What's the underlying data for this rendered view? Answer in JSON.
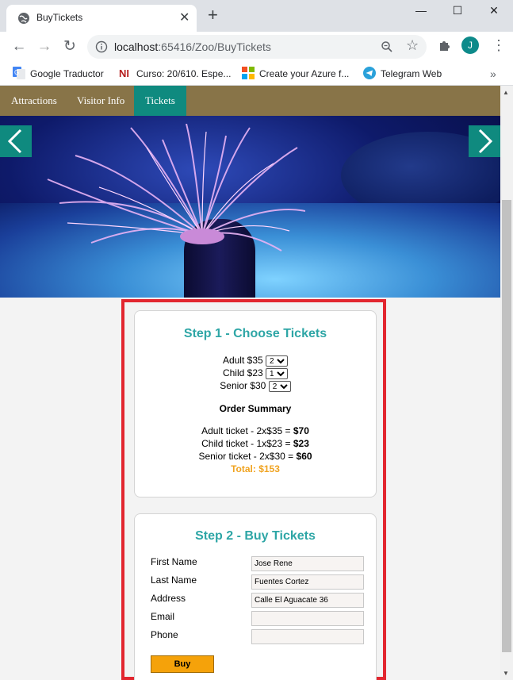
{
  "browser": {
    "tab_title": "BuyTickets",
    "tab_close": "✕",
    "new_tab": "+",
    "window_buttons": {
      "minimize": "—",
      "maximize": "☐",
      "close": "✕"
    },
    "url_host": "localhost",
    "url_rest": ":65416/Zoo/BuyTickets",
    "profile_initial": "J",
    "bookmarks": [
      {
        "label": "Google Traductor",
        "icon": "google-translate-icon"
      },
      {
        "label": "Curso: 20/610. Espe...",
        "icon": "ni-icon"
      },
      {
        "label": "Create your Azure f...",
        "icon": "microsoft-icon"
      },
      {
        "label": "Telegram Web",
        "icon": "telegram-icon"
      }
    ],
    "bookmarks_more": "»"
  },
  "site_nav": {
    "items": [
      {
        "label": "Attractions",
        "active": false
      },
      {
        "label": "Visitor Info",
        "active": false
      },
      {
        "label": "Tickets",
        "active": true
      }
    ]
  },
  "step1": {
    "title": "Step 1 - Choose Tickets",
    "tickets": [
      {
        "label": "Adult",
        "price": "$35",
        "quantity": "2"
      },
      {
        "label": "Child",
        "price": "$23",
        "quantity": "1"
      },
      {
        "label": "Senior",
        "price": "$30",
        "quantity": "2"
      }
    ],
    "summary_title": "Order Summary",
    "summary_lines": [
      {
        "text": "Adult ticket - 2x$35 = ",
        "amount": "$70"
      },
      {
        "text": "Child ticket - 1x$23 = ",
        "amount": "$23"
      },
      {
        "text": "Senior ticket - 2x$30 = ",
        "amount": "$60"
      }
    ],
    "total": "Total: $153"
  },
  "step2": {
    "title": "Step 2 - Buy Tickets",
    "fields": [
      {
        "label": "First Name",
        "value": "Jose Rene"
      },
      {
        "label": "Last Name",
        "value": "Fuentes Cortez"
      },
      {
        "label": "Address",
        "value": "Calle El Aguacate 36"
      },
      {
        "label": "Email",
        "value": ""
      },
      {
        "label": "Phone",
        "value": ""
      }
    ],
    "buy_label": "Buy"
  },
  "colors": {
    "nav_bar": "#887448",
    "nav_active": "#0f8a7f",
    "title_teal": "#2ea6a6",
    "total_orange": "#f0a320",
    "buy_button": "#f5a20a",
    "highlight_border": "#e2262f"
  }
}
